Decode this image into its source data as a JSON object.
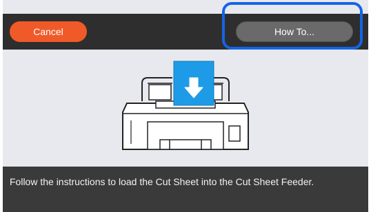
{
  "colors": {
    "cancel_bg": "#f05a28",
    "howto_bg": "#6a6a6a",
    "highlight": "#1464e6",
    "screen_bg": "#e8e9ee",
    "bar_bg": "#2e2e2e",
    "arrow_box": "#1e9be6"
  },
  "toolbar": {
    "cancel_label": "Cancel",
    "howto_label": "How To..."
  },
  "illustration": {
    "icon": "arrow-down-icon",
    "subject": "printer-cut-sheet-feeder-icon"
  },
  "footer": {
    "instruction": "Follow the instructions to load the Cut Sheet into the Cut Sheet Feeder."
  }
}
